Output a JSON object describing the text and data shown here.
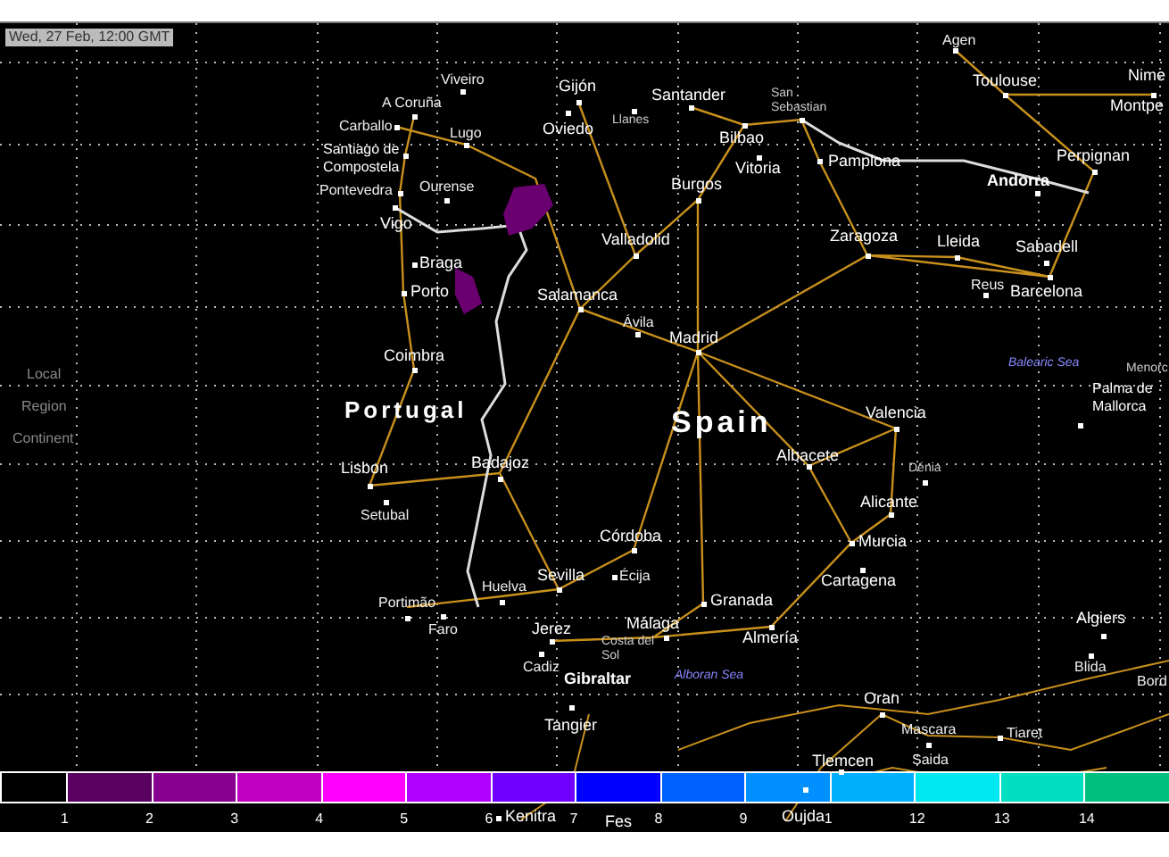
{
  "timestamp": "Wed, 27 Feb, 12:00 GMT",
  "view_menu": [
    {
      "label": "Local"
    },
    {
      "label": "Region"
    },
    {
      "label": "Continent"
    }
  ],
  "countries": [
    {
      "name": "Portugal"
    },
    {
      "name": "Spain"
    }
  ],
  "seas": [
    {
      "name": "Balearic Sea"
    },
    {
      "name": "Alboran Sea"
    }
  ],
  "cities": [
    {
      "name": "Agen",
      "kind": "minor"
    },
    {
      "name": "Toulouse",
      "kind": "major"
    },
    {
      "name": "Nime",
      "kind": "major"
    },
    {
      "name": "Montpe",
      "kind": "major"
    },
    {
      "name": "Perpignan",
      "kind": "major"
    },
    {
      "name": "Andorra",
      "kind": "capital"
    },
    {
      "name": "Viveiro",
      "kind": "minor"
    },
    {
      "name": "A Coruña",
      "kind": "minor"
    },
    {
      "name": "Carballo",
      "kind": "minor"
    },
    {
      "name": "Lugo",
      "kind": "minor"
    },
    {
      "name": "Santiago de Compostela",
      "kind": "stacked"
    },
    {
      "name": "Pontevedra",
      "kind": "minor"
    },
    {
      "name": "Ourense",
      "kind": "minor"
    },
    {
      "name": "Vigo",
      "kind": "major"
    },
    {
      "name": "Braga",
      "kind": "major"
    },
    {
      "name": "Porto",
      "kind": "major"
    },
    {
      "name": "Gijón",
      "kind": "major"
    },
    {
      "name": "Oviedo",
      "kind": "major"
    },
    {
      "name": "Llanes",
      "kind": "small"
    },
    {
      "name": "Santander",
      "kind": "major"
    },
    {
      "name": "San Sebastian",
      "kind": "small"
    },
    {
      "name": "Bilbao",
      "kind": "major"
    },
    {
      "name": "Vitoria",
      "kind": "major"
    },
    {
      "name": "Pamplona",
      "kind": "major"
    },
    {
      "name": "Burgos",
      "kind": "major"
    },
    {
      "name": "Valladolid",
      "kind": "major"
    },
    {
      "name": "Salamanca",
      "kind": "major"
    },
    {
      "name": "Zaragoza",
      "kind": "major"
    },
    {
      "name": "Lleida",
      "kind": "major"
    },
    {
      "name": "Sabadell",
      "kind": "major"
    },
    {
      "name": "Reus",
      "kind": "minor"
    },
    {
      "name": "Barcelona",
      "kind": "major"
    },
    {
      "name": "Ávila",
      "kind": "minor"
    },
    {
      "name": "Madrid",
      "kind": "major"
    },
    {
      "name": "Coimbra",
      "kind": "major"
    },
    {
      "name": "Lisbon",
      "kind": "major"
    },
    {
      "name": "Setubal",
      "kind": "minor"
    },
    {
      "name": "Badajoz",
      "kind": "major"
    },
    {
      "name": "Valencia",
      "kind": "major"
    },
    {
      "name": "Albacete",
      "kind": "major"
    },
    {
      "name": "Dénia",
      "kind": "small"
    },
    {
      "name": "Alicante",
      "kind": "major"
    },
    {
      "name": "Murcia",
      "kind": "major"
    },
    {
      "name": "Cartagena",
      "kind": "major"
    },
    {
      "name": "Córdoba",
      "kind": "major"
    },
    {
      "name": "Sevilla",
      "kind": "major"
    },
    {
      "name": "Écija",
      "kind": "minor"
    },
    {
      "name": "Huelva",
      "kind": "minor"
    },
    {
      "name": "Portimão",
      "kind": "minor"
    },
    {
      "name": "Faro",
      "kind": "minor"
    },
    {
      "name": "Jerez",
      "kind": "major"
    },
    {
      "name": "Cadiz",
      "kind": "minor"
    },
    {
      "name": "Gibraltar",
      "kind": "capital"
    },
    {
      "name": "Granada",
      "kind": "major"
    },
    {
      "name": "Málaga",
      "kind": "major"
    },
    {
      "name": "Costa del Sol",
      "kind": "small"
    },
    {
      "name": "Almería",
      "kind": "major"
    },
    {
      "name": "Palma de Mallorca",
      "kind": "stacked"
    },
    {
      "name": "Menorc",
      "kind": "small"
    },
    {
      "name": "Algiers",
      "kind": "major"
    },
    {
      "name": "Blida",
      "kind": "minor"
    },
    {
      "name": "Bord",
      "kind": "minor"
    },
    {
      "name": "Tangier",
      "kind": "major"
    },
    {
      "name": "Oran",
      "kind": "major"
    },
    {
      "name": "Mascara",
      "kind": "minor"
    },
    {
      "name": "Tiaret",
      "kind": "minor"
    },
    {
      "name": "Tlemcen",
      "kind": "major"
    },
    {
      "name": "Saida",
      "kind": "minor"
    },
    {
      "name": "Kenitra",
      "kind": "major"
    },
    {
      "name": "Fes",
      "kind": "major"
    },
    {
      "name": "Oujda",
      "kind": "major"
    }
  ],
  "legend": {
    "steps": [
      {
        "color": "#000000"
      },
      {
        "color": "#5a0060"
      },
      {
        "color": "#880090"
      },
      {
        "color": "#c000c0"
      },
      {
        "color": "#ff00ff"
      },
      {
        "color": "#b000ff"
      },
      {
        "color": "#7000ff"
      },
      {
        "color": "#0000ff"
      },
      {
        "color": "#0060ff"
      },
      {
        "color": "#0090ff"
      },
      {
        "color": "#00b0ff"
      },
      {
        "color": "#00e8f0"
      },
      {
        "color": "#00e0c0"
      },
      {
        "color": "#00c080"
      }
    ],
    "ticks": [
      "1",
      "2",
      "3",
      "4",
      "5",
      "6",
      "7",
      "8",
      "9",
      "1",
      "12",
      "13",
      "14"
    ]
  }
}
